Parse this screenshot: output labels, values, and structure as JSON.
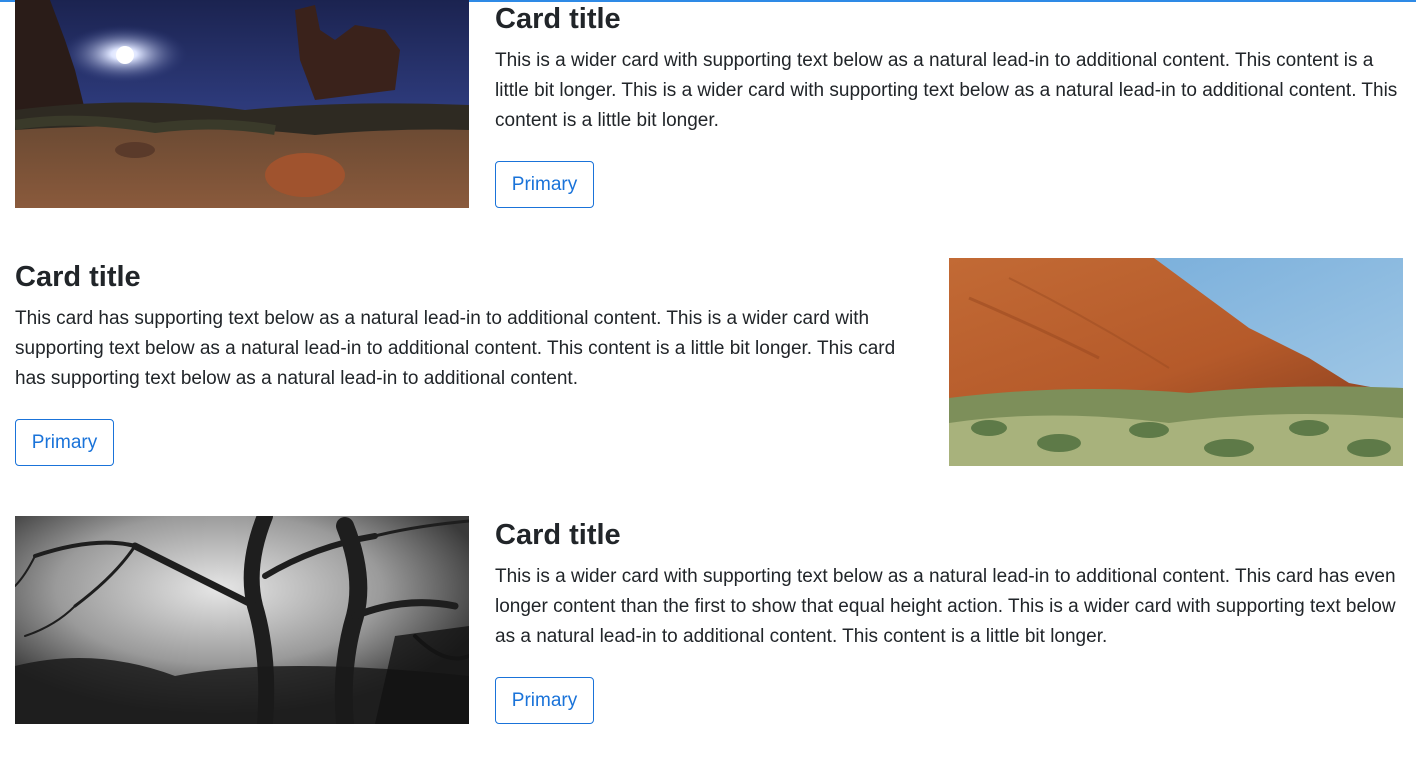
{
  "cards": [
    {
      "title": "Card title",
      "text": "This is a wider card with supporting text below as a natural lead-in to additional content. This content is a little bit longer. This is a wider card with supporting text below as a natural lead-in to additional content. This content is a little bit longer.",
      "button_label": "Primary",
      "image": "night-desert-landscape"
    },
    {
      "title": "Card title",
      "text": "This card has supporting text below as a natural lead-in to additional content. This is a wider card with supporting text below as a natural lead-in to additional content. This content is a little bit longer. This card has supporting text below as a natural lead-in to additional content.",
      "button_label": "Primary",
      "image": "red-rock-desert-landscape"
    },
    {
      "title": "Card title",
      "text": "This is a wider card with supporting text below as a natural lead-in to additional content. This card has even longer content than the first to show that equal height action. This is a wider card with supporting text below as a natural lead-in to additional content. This content is a little bit longer.",
      "button_label": "Primary",
      "image": "black-and-white-forest"
    }
  ],
  "colors": {
    "accent": "#1a73d9",
    "text": "#212529",
    "background": "#ffffff"
  }
}
